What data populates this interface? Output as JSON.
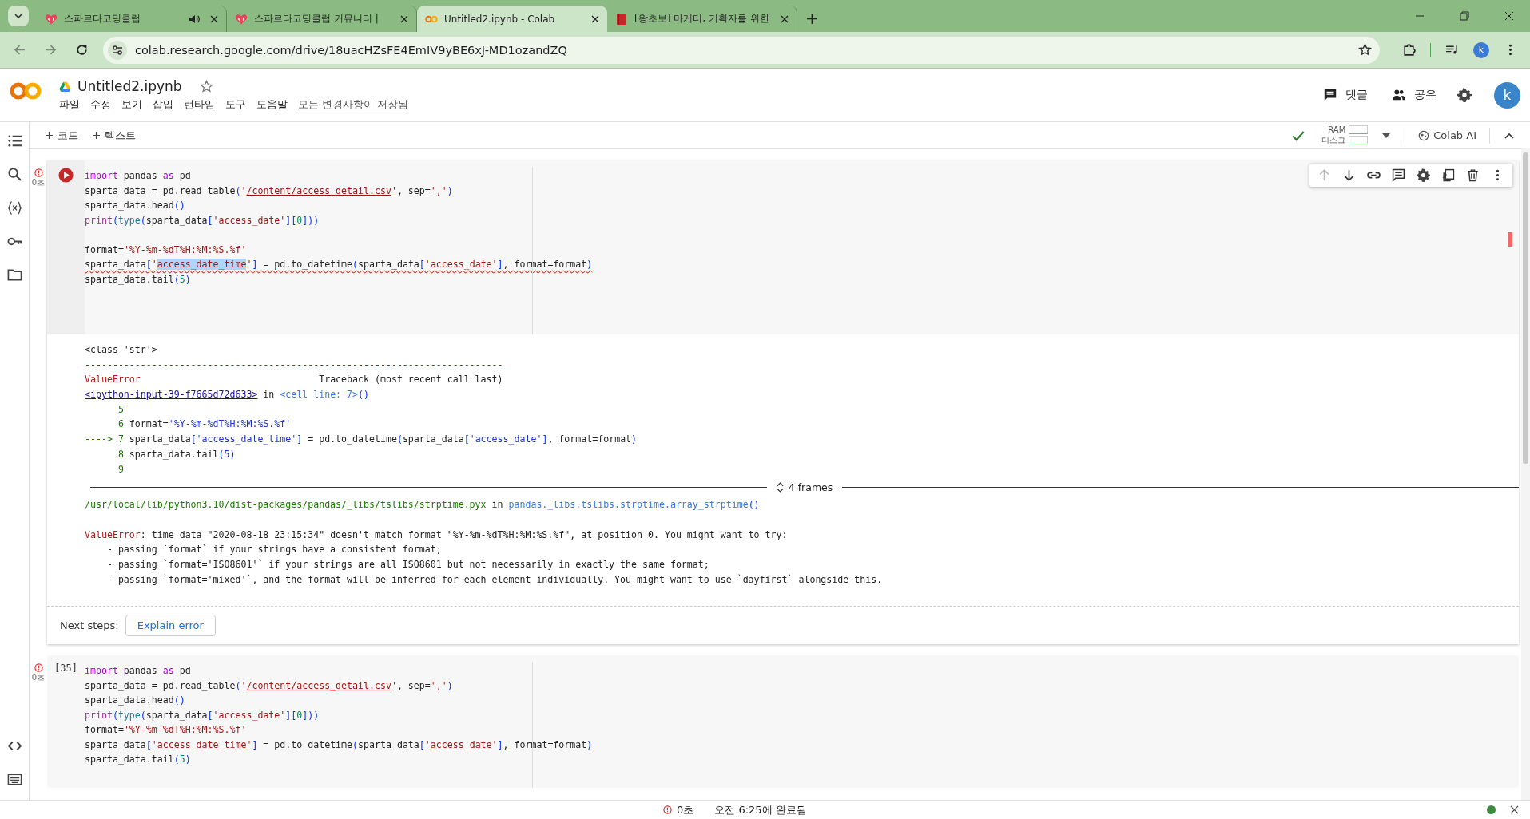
{
  "browser": {
    "tabs": [
      {
        "title": "스파르타코딩클럽",
        "selected": false,
        "audio": true
      },
      {
        "title": "스파르타코딩클럽 커뮤니티 |",
        "selected": false,
        "audio": false
      },
      {
        "title": "Untitled2.ipynb - Colab",
        "selected": true,
        "audio": false
      },
      {
        "title": "[왕초보] 마케터, 기획자를 위한",
        "selected": false,
        "audio": false
      }
    ],
    "address": "colab.research.google.com/drive/18uacHZsFE4EmIV9yBE6xJ-MD1ozandZQ",
    "profile": "k"
  },
  "notebook": {
    "title": "Untitled2.ipynb",
    "menu": [
      "파일",
      "수정",
      "보기",
      "삽입",
      "런타임",
      "도구",
      "도움말"
    ],
    "save_status": "모든 변경사항이 저장됨",
    "comment": "댓글",
    "share": "공유",
    "avatar": "k"
  },
  "toolbar": {
    "add_code": "코드",
    "add_text": "텍스트",
    "connected": true,
    "ram_label": "RAM",
    "disk_label": "디스크",
    "ai": "Colab AI"
  },
  "cells": [
    {
      "focused": true,
      "error": true,
      "time": "0초",
      "lines": [
        {
          "kind": "code",
          "tokens": [
            {
              "text": "import",
              "kind": "kw"
            },
            {
              "text": " pandas ",
              "kind": "p"
            },
            {
              "text": "as",
              "kind": "kw"
            },
            {
              "text": " pd",
              "kind": "p"
            }
          ]
        },
        {
          "kind": "code",
          "tokens": [
            {
              "text": "sparta_data = pd.read_table",
              "kind": "p"
            },
            {
              "text": "(",
              "kind": "br"
            },
            {
              "text": "'",
              "kind": "str"
            },
            {
              "text": "/content/access_detail.csv",
              "kind": "link"
            },
            {
              "text": "'",
              "kind": "str"
            },
            {
              "text": ", sep=",
              "kind": "p"
            },
            {
              "text": "','",
              "kind": "str"
            },
            {
              "text": ")",
              "kind": "br"
            }
          ]
        },
        {
          "kind": "code",
          "tokens": [
            {
              "text": "sparta_data.head",
              "kind": "p"
            },
            {
              "text": "()",
              "kind": "br"
            }
          ]
        },
        {
          "kind": "code",
          "tokens": [
            {
              "text": "print",
              "kind": "fn"
            },
            {
              "text": "(",
              "kind": "br"
            },
            {
              "text": "type",
              "kind": "ty"
            },
            {
              "text": "(",
              "kind": "br"
            },
            {
              "text": "sparta_data",
              "kind": "p"
            },
            {
              "text": "[",
              "kind": "br"
            },
            {
              "text": "'access_date'",
              "kind": "str"
            },
            {
              "text": "]",
              "kind": "br"
            },
            {
              "text": "[",
              "kind": "br"
            },
            {
              "text": "0",
              "kind": "num"
            },
            {
              "text": "]",
              "kind": "br"
            },
            {
              "text": "))",
              "kind": "br"
            }
          ]
        },
        {
          "kind": "blank"
        },
        {
          "kind": "code",
          "tokens": [
            {
              "text": "format=",
              "kind": "p"
            },
            {
              "text": "'%Y-%m-%dT%H:%M:%S.%f'",
              "kind": "str"
            }
          ]
        },
        {
          "kind": "code",
          "squiggle": true,
          "tokens": [
            {
              "text": "sparta_data",
              "kind": "p"
            },
            {
              "text": "[",
              "kind": "br"
            },
            {
              "text": "'",
              "kind": "str"
            },
            {
              "text": "access_date_time",
              "kind": "sel"
            },
            {
              "text": "'",
              "kind": "str"
            },
            {
              "text": "]",
              "kind": "br"
            },
            {
              "text": " = pd.to_datetime",
              "kind": "p"
            },
            {
              "text": "(",
              "kind": "br"
            },
            {
              "text": "sparta_data",
              "kind": "p"
            },
            {
              "text": "[",
              "kind": "br"
            },
            {
              "text": "'access_date'",
              "kind": "str"
            },
            {
              "text": "]",
              "kind": "br"
            },
            {
              "text": ", format=format",
              "kind": "p"
            },
            {
              "text": ")",
              "kind": "br"
            }
          ]
        },
        {
          "kind": "code",
          "tokens": [
            {
              "text": "sparta_data.tail",
              "kind": "p"
            },
            {
              "text": "(",
              "kind": "br"
            },
            {
              "text": "5",
              "kind": "num"
            },
            {
              "text": ")",
              "kind": "br"
            }
          ]
        }
      ],
      "output": [
        {
          "kind": "line",
          "tokens": [
            {
              "text": "<class 'str'>",
              "kind": "p"
            }
          ]
        },
        {
          "kind": "line",
          "tokens": [
            {
              "text": "---------------------------------------------------------------------------",
              "kind": "err"
            }
          ]
        },
        {
          "kind": "line",
          "tokens": [
            {
              "text": "ValueError",
              "kind": "err"
            },
            {
              "text": "                                Traceback (most recent call last)",
              "kind": "p"
            }
          ]
        },
        {
          "kind": "line",
          "tokens": [
            {
              "text": "<ipython-input-39-f7665d72d633>",
              "kind": "olink"
            },
            {
              "text": " in ",
              "kind": "p"
            },
            {
              "text": "<cell line: 7>",
              "kind": "blue"
            },
            {
              "text": "()",
              "kind": "br"
            }
          ]
        },
        {
          "kind": "line",
          "tokens": [
            {
              "text": "      5",
              "kind": "green"
            }
          ]
        },
        {
          "kind": "line",
          "tokens": [
            {
              "text": "      6 ",
              "kind": "green"
            },
            {
              "text": "format=",
              "kind": "p"
            },
            {
              "text": "'%Y-%m-%dT%H:%M:%S.%f'",
              "kind": "ostr"
            }
          ]
        },
        {
          "kind": "line",
          "tokens": [
            {
              "text": "----> 7 ",
              "kind": "green"
            },
            {
              "text": "sparta_data",
              "kind": "p"
            },
            {
              "text": "[",
              "kind": "br"
            },
            {
              "text": "'access_date_time'",
              "kind": "ostr"
            },
            {
              "text": "]",
              "kind": "br"
            },
            {
              "text": " = pd.to_datetime",
              "kind": "p"
            },
            {
              "text": "(",
              "kind": "br"
            },
            {
              "text": "sparta_data",
              "kind": "p"
            },
            {
              "text": "[",
              "kind": "br"
            },
            {
              "text": "'access_date'",
              "kind": "ostr"
            },
            {
              "text": "]",
              "kind": "br"
            },
            {
              "text": ", format=format",
              "kind": "p"
            },
            {
              "text": ")",
              "kind": "br"
            }
          ]
        },
        {
          "kind": "line",
          "tokens": [
            {
              "text": "      8 ",
              "kind": "green"
            },
            {
              "text": "sparta_data.tail",
              "kind": "p"
            },
            {
              "text": "(",
              "kind": "br"
            },
            {
              "text": "5",
              "kind": "ostr"
            },
            {
              "text": ")",
              "kind": "br"
            }
          ]
        },
        {
          "kind": "line",
          "tokens": [
            {
              "text": "      9",
              "kind": "green"
            }
          ]
        },
        {
          "kind": "divider",
          "label": "4 frames"
        },
        {
          "kind": "line",
          "tokens": [
            {
              "text": "/usr/local/lib/python3.10/dist-packages/pandas/_libs/tslibs/strptime.pyx",
              "kind": "green"
            },
            {
              "text": " in ",
              "kind": "p"
            },
            {
              "text": "pandas._libs.tslibs.strptime.array_strptime",
              "kind": "blue"
            },
            {
              "text": "()",
              "kind": "br"
            }
          ]
        },
        {
          "kind": "blank"
        },
        {
          "kind": "line",
          "tokens": [
            {
              "text": "ValueError",
              "kind": "err"
            },
            {
              "text": ": time data \"2020-08-18 23:15:34\" doesn't match format \"%Y-%m-%dT%H:%M:%S.%f\", at position 0. You might want to try:",
              "kind": "p"
            }
          ]
        },
        {
          "kind": "line",
          "tokens": [
            {
              "text": "    - passing `format` if your strings have a consistent format;",
              "kind": "p"
            }
          ]
        },
        {
          "kind": "line",
          "tokens": [
            {
              "text": "    - passing `format='ISO8601'` if your strings are all ISO8601 but not necessarily in exactly the same format;",
              "kind": "p"
            }
          ]
        },
        {
          "kind": "line",
          "tokens": [
            {
              "text": "    - passing `format='mixed'`, and the format will be inferred for each element individually. You might want to use `dayfirst` alongside this.",
              "kind": "p"
            }
          ]
        }
      ],
      "next_steps": {
        "label": "Next steps:",
        "button": "Explain error"
      }
    },
    {
      "focused": false,
      "error": true,
      "time": "0초",
      "exec_count": "[35]",
      "lines": [
        {
          "kind": "code",
          "tokens": [
            {
              "text": "import",
              "kind": "kw"
            },
            {
              "text": " pandas ",
              "kind": "p"
            },
            {
              "text": "as",
              "kind": "kw"
            },
            {
              "text": " pd",
              "kind": "p"
            }
          ]
        },
        {
          "kind": "code",
          "tokens": [
            {
              "text": "sparta_data = pd.read_table",
              "kind": "p"
            },
            {
              "text": "(",
              "kind": "br"
            },
            {
              "text": "'",
              "kind": "str"
            },
            {
              "text": "/content/access_detail.csv",
              "kind": "link"
            },
            {
              "text": "'",
              "kind": "str"
            },
            {
              "text": ", sep=",
              "kind": "p"
            },
            {
              "text": "','",
              "kind": "str"
            },
            {
              "text": ")",
              "kind": "br"
            }
          ]
        },
        {
          "kind": "code",
          "tokens": [
            {
              "text": "sparta_data.head",
              "kind": "p"
            },
            {
              "text": "()",
              "kind": "br"
            }
          ]
        },
        {
          "kind": "code",
          "tokens": [
            {
              "text": "print",
              "kind": "fn"
            },
            {
              "text": "(",
              "kind": "br"
            },
            {
              "text": "type",
              "kind": "ty"
            },
            {
              "text": "(",
              "kind": "br"
            },
            {
              "text": "sparta_data",
              "kind": "p"
            },
            {
              "text": "[",
              "kind": "br"
            },
            {
              "text": "'access_date'",
              "kind": "str"
            },
            {
              "text": "]",
              "kind": "br"
            },
            {
              "text": "[",
              "kind": "br"
            },
            {
              "text": "0",
              "kind": "num"
            },
            {
              "text": "]",
              "kind": "br"
            },
            {
              "text": "))",
              "kind": "br"
            }
          ]
        },
        {
          "kind": "code",
          "tokens": [
            {
              "text": "format=",
              "kind": "p"
            },
            {
              "text": "'%Y-%m-%dT%H:%M:%S.%f'",
              "kind": "str"
            }
          ]
        },
        {
          "kind": "code",
          "tokens": [
            {
              "text": "sparta_data",
              "kind": "p"
            },
            {
              "text": "[",
              "kind": "br"
            },
            {
              "text": "'access_date_time'",
              "kind": "str"
            },
            {
              "text": "]",
              "kind": "br"
            },
            {
              "text": " = pd.to_datetime",
              "kind": "p"
            },
            {
              "text": "(",
              "kind": "br"
            },
            {
              "text": "sparta_data",
              "kind": "p"
            },
            {
              "text": "[",
              "kind": "br"
            },
            {
              "text": "'access_date'",
              "kind": "str"
            },
            {
              "text": "]",
              "kind": "br"
            },
            {
              "text": ", format=format",
              "kind": "p"
            },
            {
              "text": ")",
              "kind": "br"
            }
          ]
        },
        {
          "kind": "code",
          "tokens": [
            {
              "text": "sparta_data.tail",
              "kind": "p"
            },
            {
              "text": "(",
              "kind": "br"
            },
            {
              "text": "5",
              "kind": "num"
            },
            {
              "text": ")",
              "kind": "br"
            }
          ]
        }
      ]
    }
  ],
  "status_bar": {
    "error": true,
    "time": "0초",
    "message": "오전 6:25에 완료됨",
    "connected": true
  }
}
